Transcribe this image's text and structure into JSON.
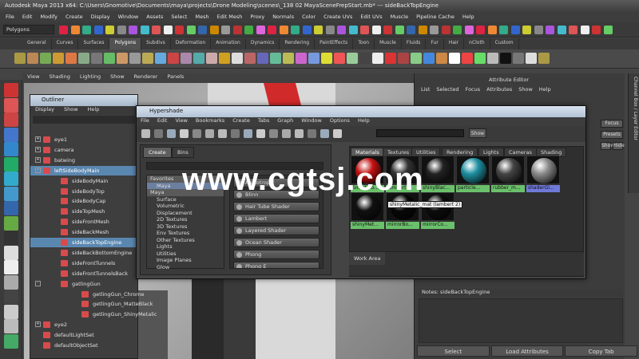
{
  "window": {
    "title": "Autodesk Maya 2013 x64: C:\\Users\\Gnomotive\\Documents\\maya\\projects\\Drone Modeling\\scenes\\_138 02 MayaSceneFrepStart.mb* --- sideBackTopEngine"
  },
  "menubar": [
    "File",
    "Edit",
    "Modify",
    "Create",
    "Display",
    "Window",
    "Assets",
    "Select",
    "Mesh",
    "Edit Mesh",
    "Proxy",
    "Normals",
    "Color",
    "Create UVs",
    "Edit UVs",
    "Muscle",
    "Pipeline Cache",
    "Help"
  ],
  "mode": "Polygons",
  "shelf_tabs": [
    "General",
    "Curves",
    "Surfaces",
    "Polygons",
    "Subdivs",
    "Deformation",
    "Animation",
    "Dynamics",
    "Rendering",
    "PaintEffects",
    "Toon",
    "Muscle",
    "Fluids",
    "Fur",
    "Hair",
    "nCloth",
    "Custom"
  ],
  "shelf_active": "Polygons",
  "panel_menu": [
    "View",
    "Shading",
    "Lighting",
    "Show",
    "Renderer",
    "Panels"
  ],
  "outliner": {
    "title": "Outliner",
    "menu": [
      "Display",
      "Show",
      "Help"
    ],
    "items": [
      {
        "label": "eye1",
        "indent": 1,
        "expand": "+"
      },
      {
        "label": "camera",
        "indent": 1,
        "expand": "+"
      },
      {
        "label": "batwing",
        "indent": 1,
        "expand": "+"
      },
      {
        "label": "leftSideBodyMain",
        "indent": 1,
        "expand": "-",
        "selected": true
      },
      {
        "label": "sideBodyMain",
        "indent": 2
      },
      {
        "label": "sideBodyTop",
        "indent": 2
      },
      {
        "label": "sideBodyCap",
        "indent": 2
      },
      {
        "label": "sideTopMesh",
        "indent": 2
      },
      {
        "label": "sideFrontMesh",
        "indent": 2
      },
      {
        "label": "sideBackMesh",
        "indent": 2
      },
      {
        "label": "sideBackTopEngine",
        "indent": 2,
        "selected": true
      },
      {
        "label": "sideBackBottomEngine",
        "indent": 2
      },
      {
        "label": "sideFrontTunnels",
        "indent": 2
      },
      {
        "label": "sideFrontTunnelsBack",
        "indent": 2
      },
      {
        "label": "gatlingGun",
        "indent": 2,
        "expand": "-"
      },
      {
        "label": "getlingGun_Chrome",
        "indent": 3
      },
      {
        "label": "getlingGun_MatteBlack",
        "indent": 3
      },
      {
        "label": "getlingGun_ShinyMetalic",
        "indent": 3
      },
      {
        "label": "eye2",
        "indent": 1,
        "expand": "+"
      },
      {
        "label": "defaultLightSet",
        "indent": 1
      },
      {
        "label": "defaultObjectSet",
        "indent": 1
      }
    ]
  },
  "hypershade": {
    "title": "Hypershade",
    "menu": [
      "File",
      "Edit",
      "View",
      "Bookmarks",
      "Create",
      "Tabs",
      "Graph",
      "Window",
      "Options",
      "Help"
    ],
    "show_button": "Show",
    "left_tabs": [
      "Create",
      "Bins"
    ],
    "category_list": [
      {
        "label": "Favorites",
        "header": true
      },
      {
        "label": "Maya"
      },
      {
        "label": "Maya",
        "header": true
      },
      {
        "label": "Surface"
      },
      {
        "label": "Volumetric"
      },
      {
        "label": "Displacement"
      },
      {
        "label": "2D Textures"
      },
      {
        "label": "3D Textures"
      },
      {
        "label": "Env Textures"
      },
      {
        "label": "Other Textures"
      },
      {
        "label": "Lights"
      },
      {
        "label": "Utilities"
      },
      {
        "label": "Image Planes"
      },
      {
        "label": "Glow"
      }
    ],
    "create_nodes": [
      "Anisotropic",
      "Blinn",
      "Hair Tube Shader",
      "Lambert",
      "Layered Shader",
      "Ocean Shader",
      "Phong",
      "Phong E"
    ],
    "right_tabs": [
      "Materials",
      "Textures",
      "Utilities",
      "Rendering",
      "Lights",
      "Cameras",
      "Shading"
    ],
    "swatches": [
      {
        "label": "SmartBlo...",
        "color": "#c21313",
        "label_color": "green"
      },
      {
        "label": "lambert1",
        "color": "#333333",
        "label_color": "green"
      },
      {
        "label": "shinyBlac...",
        "color": "#222222",
        "label_color": "green"
      },
      {
        "label": "particle...",
        "color": "#1e8fa0",
        "label_color": "green"
      },
      {
        "label": "rubber_m...",
        "color": "#444444",
        "label_color": "green"
      },
      {
        "label": "shaderGl...",
        "color": "#8a8a8a",
        "label_color": "blue"
      },
      {
        "label": "shinyMet...",
        "color": "#111111",
        "label_color": "green"
      },
      {
        "label": "mirrorBo...",
        "color": "#080808",
        "label_color": "green"
      },
      {
        "label": "mirrorCo...",
        "color": "#0d0d0d",
        "label_color": "green"
      }
    ],
    "tooltip": "shinyMetalic_mat (lambert 2)",
    "work_area_tab": "Work Area"
  },
  "attribute_editor": {
    "title": "Attribute Editor",
    "menu": [
      "List",
      "Selected",
      "Focus",
      "Attributes",
      "Show",
      "Help"
    ],
    "side_buttons": [
      "Focus",
      "Presets",
      "Show",
      "Hide"
    ],
    "notes_label": "Notes: sideBackTopEngine",
    "buttons": [
      "Select",
      "Load Attributes",
      "Copy Tab"
    ]
  },
  "side_tab": "Channel Box / Layer Editor",
  "watermark": "www.cgtsj.com"
}
